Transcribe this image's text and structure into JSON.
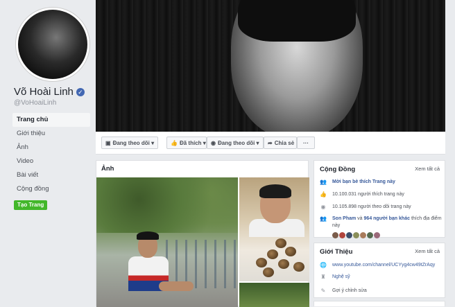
{
  "profile": {
    "name": "Võ Hoài Linh",
    "handle": "@VoHoaiLinh",
    "verified_mark": "✓"
  },
  "nav": {
    "items": [
      "Trang chủ",
      "Giới thiệu",
      "Ảnh",
      "Video",
      "Bài viết",
      "Cộng đồng"
    ],
    "active_index": 0
  },
  "create_page_label": "Tạo Trang",
  "actions": {
    "following_top": "Đang theo dõi",
    "liked": "Đã thích",
    "following": "Đang theo dõi",
    "share": "Chia sẻ",
    "more": "···"
  },
  "photos": {
    "title": "Ảnh"
  },
  "community": {
    "title": "Cộng Đồng",
    "see_all": "Xem tất cả",
    "invite": "Mời bạn bè thích Trang này",
    "likes": "10.100.031 người thích trang này",
    "followers": "10.105.898 người theo dõi trang này",
    "friends_prefix": "Son Pham",
    "friends_mid": " và ",
    "friends_count": "964 người bạn khác",
    "friends_suffix": " thích địa điểm này"
  },
  "intro": {
    "title": "Giới Thiệu",
    "see_all": "Xem tất cả",
    "website": "www.youtube.com/channel/UCYyg4cw49tZrAqy",
    "category": "Nghệ sỹ",
    "suggest_edit": "Gợi ý chỉnh sửa"
  },
  "colors": {
    "brand": "#4267b2",
    "link": "#365899",
    "create_button": "#42b72a",
    "background": "#e9ebee"
  },
  "icons": [
    "verified-icon",
    "thumb-up-icon",
    "rss-icon",
    "share-icon",
    "users-icon",
    "globe-icon",
    "edit-icon",
    "person-icon"
  ]
}
